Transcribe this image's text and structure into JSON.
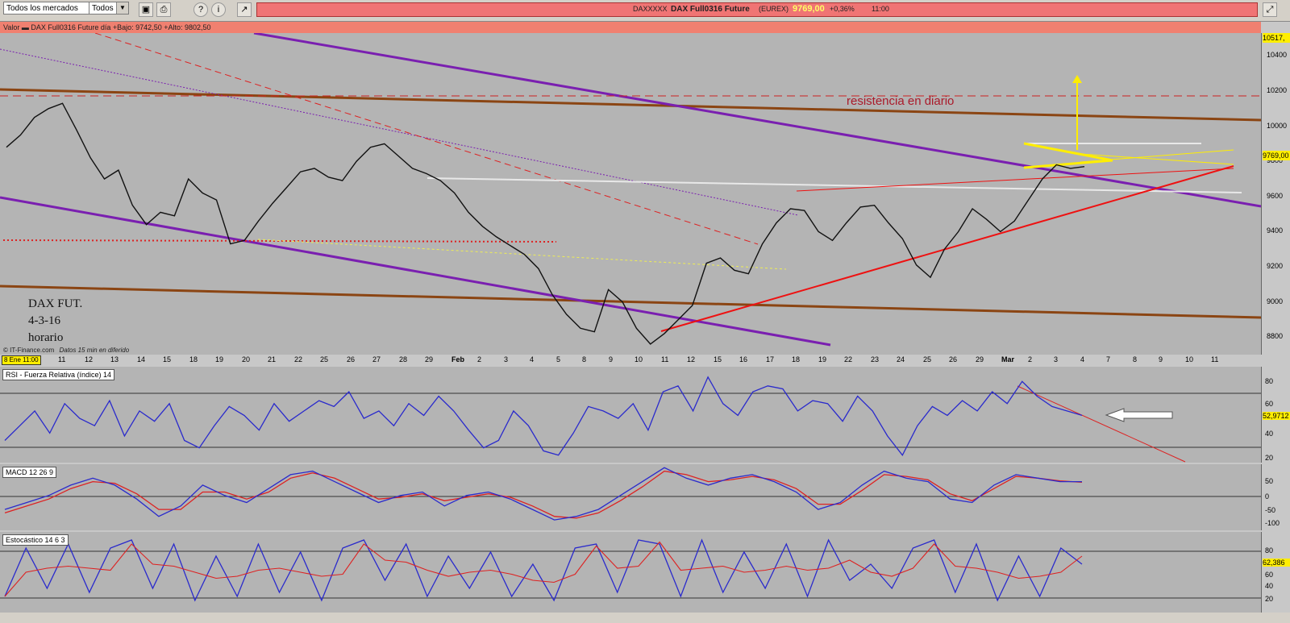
{
  "toolbar": {
    "market_select": "Todos los mercados",
    "filter_select": "Todos",
    "symbol_code": "DAXXXXX",
    "symbol_name": "DAX Full0316 Future",
    "exchange": "(EUREX)",
    "last_price": "9769,00",
    "change": "+0,36%",
    "time": "11:00",
    "icons": [
      "save-icon",
      "print-icon",
      "help-icon",
      "info-icon",
      "chart-icon",
      "chart-toggle-icon"
    ]
  },
  "main_panel": {
    "header": "Valor      ▬ DAX Full0316 Future     día +Bajo: 9742,50 +Alto: 9802,50",
    "annotation_resistance": "resistencia en diario",
    "note_lines": [
      "DAX FUT.",
      "4-3-16",
      "horario"
    ],
    "source_credit": "© IT-Finance.com",
    "delay_note": "Datos 15 min en diferido",
    "cursor_label": "8 Ene 11:00",
    "price_label": "9769,00",
    "top_label": "10517,",
    "y_ticks": [
      "10400",
      "10200",
      "10000",
      "9800",
      "9600",
      "9400",
      "9200",
      "9000",
      "8800"
    ]
  },
  "x_axis": {
    "labels": [
      "11",
      "12",
      "13",
      "14",
      "15",
      "18",
      "19",
      "20",
      "21",
      "22",
      "25",
      "26",
      "27",
      "28",
      "29",
      "Feb",
      "2",
      "3",
      "4",
      "5",
      "8",
      "9",
      "10",
      "11",
      "12",
      "15",
      "16",
      "17",
      "18",
      "19",
      "22",
      "23",
      "24",
      "25",
      "26",
      "29",
      "Mar",
      "2",
      "3",
      "4",
      "7",
      "8",
      "9",
      "10",
      "11"
    ]
  },
  "rsi_panel": {
    "label": "RSI - Fuerza Relativa (índice) 14",
    "value_label": "52,9712",
    "ticks": [
      "80",
      "60",
      "40",
      "20"
    ]
  },
  "macd_panel": {
    "label": "MACD 12 26 9",
    "ticks": [
      "50",
      "0",
      "-50",
      "-100"
    ]
  },
  "stoch_panel": {
    "label": "Estocástico 14 6 3",
    "value_label": "62,386",
    "ticks": [
      "80",
      "60",
      "40",
      "20"
    ]
  },
  "colors": {
    "bg": "#b4b4b4",
    "header": "#f08070",
    "rsi_line": "#2a2acc",
    "macd_red": "#dd2222"
  },
  "chart_data": [
    {
      "type": "line",
      "title": "DAX Full0316 Future",
      "ylim": [
        8700,
        10530
      ],
      "series": [
        {
          "name": "DAX Full0316 Future",
          "values": [
            9880,
            9950,
            10050,
            10100,
            10130,
            9980,
            9820,
            9700,
            9750,
            9550,
            9440,
            9510,
            9490,
            9700,
            9620,
            9580,
            9330,
            9350,
            9460,
            9560,
            9650,
            9740,
            9760,
            9710,
            9690,
            9800,
            9880,
            9900,
            9830,
            9760,
            9730,
            9690,
            9620,
            9510,
            9430,
            9370,
            9320,
            9270,
            9190,
            9040,
            8930,
            8850,
            8830,
            9070,
            9000,
            8850,
            8760,
            8820,
            8900,
            8980,
            9220,
            9250,
            9180,
            9160,
            9330,
            9450,
            9530,
            9520,
            9400,
            9350,
            9450,
            9540,
            9550,
            9450,
            9360,
            9210,
            9140,
            9300,
            9400,
            9530,
            9470,
            9400,
            9460,
            9580,
            9700,
            9780,
            9760,
            9770
          ]
        }
      ],
      "lines": {
        "resistencia_en_diario": 10135
      }
    },
    {
      "type": "line",
      "title": "RSI - Fuerza Relativa (índice) 14",
      "ylim": [
        20,
        85
      ],
      "last_value": 52.9712,
      "series": [
        {
          "name": "RSI",
          "values": [
            35,
            45,
            55,
            40,
            60,
            50,
            45,
            62,
            38,
            55,
            48,
            60,
            35,
            30,
            45,
            58,
            52,
            42,
            60,
            48,
            55,
            62,
            58,
            68,
            50,
            55,
            45,
            60,
            52,
            65,
            55,
            42,
            30,
            35,
            55,
            45,
            28,
            25,
            40,
            58,
            55,
            50,
            60,
            42,
            68,
            72,
            55,
            78,
            60,
            52,
            68,
            72,
            70,
            55,
            62,
            60,
            48,
            65,
            55,
            38,
            25,
            45,
            58,
            52,
            62,
            55,
            68,
            60,
            75,
            65,
            58,
            55,
            52
          ]
        }
      ]
    },
    {
      "type": "line",
      "title": "MACD 12 26 9",
      "ylim": [
        -120,
        70
      ],
      "series": [
        {
          "name": "MACD",
          "values": [
            -60,
            -40,
            -20,
            10,
            30,
            10,
            -30,
            -80,
            -50,
            10,
            -20,
            -40,
            0,
            40,
            50,
            20,
            -10,
            -40,
            -20,
            -10,
            -50,
            -20,
            -10,
            -30,
            -60,
            -90,
            -80,
            -60,
            -20,
            20,
            60,
            30,
            10,
            30,
            40,
            20,
            -10,
            -60,
            -40,
            10,
            50,
            30,
            20,
            -30,
            -40,
            10,
            40,
            30,
            20,
            20
          ]
        },
        {
          "name": "Signal",
          "values": [
            -70,
            -50,
            -30,
            0,
            20,
            15,
            -15,
            -60,
            -60,
            -10,
            -10,
            -30,
            -10,
            30,
            45,
            30,
            0,
            -30,
            -25,
            -15,
            -35,
            -25,
            -15,
            -25,
            -50,
            -80,
            -85,
            -70,
            -35,
            5,
            50,
            40,
            20,
            25,
            35,
            25,
            0,
            -45,
            -45,
            -5,
            40,
            35,
            25,
            -15,
            -35,
            0,
            35,
            30,
            22,
            18
          ]
        }
      ]
    },
    {
      "type": "line",
      "title": "Estocástico 14 6 3",
      "ylim": [
        0,
        100
      ],
      "last_value": 62.386,
      "series": [
        {
          "name": "%K",
          "values": [
            20,
            80,
            30,
            85,
            25,
            80,
            90,
            30,
            85,
            15,
            70,
            20,
            85,
            25,
            75,
            15,
            80,
            90,
            40,
            85,
            20,
            70,
            30,
            75,
            20,
            60,
            15,
            80,
            85,
            25,
            90,
            85,
            20,
            90,
            25,
            75,
            30,
            85,
            20,
            90,
            40,
            60,
            30,
            80,
            90,
            25,
            85,
            15,
            70,
            20,
            80,
            60
          ]
        }
      ]
    }
  ]
}
